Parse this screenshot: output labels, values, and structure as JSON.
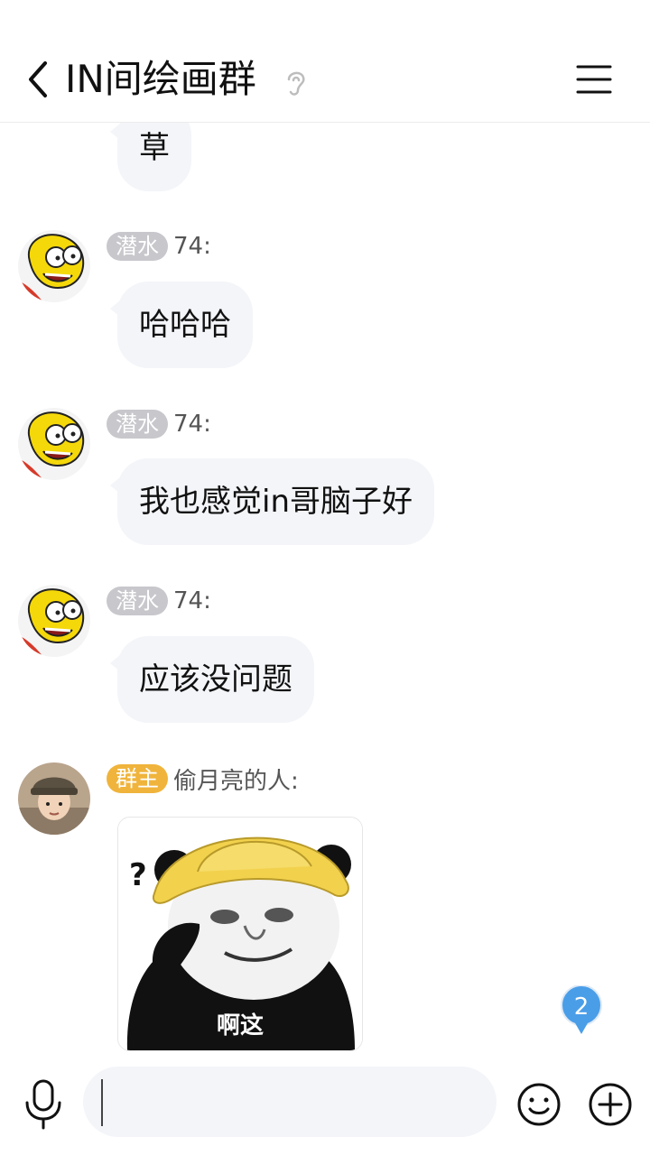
{
  "header": {
    "title": "IN间绘画群",
    "back_icon": "chevron-left-icon",
    "listen_icon": "ear-icon",
    "menu_icon": "hamburger-menu-icon"
  },
  "messages": [
    {
      "type": "text",
      "text": "草"
    },
    {
      "type": "text",
      "badge": "潜水",
      "sender": "74:",
      "text": "哈哈哈"
    },
    {
      "type": "text",
      "badge": "潜水",
      "sender": "74:",
      "text": "我也感觉in哥脑子好"
    },
    {
      "type": "text",
      "badge": "潜水",
      "sender": "74:",
      "text": "应该没问题"
    },
    {
      "type": "sticker",
      "badge": "群主",
      "sender": "偷月亮的人:",
      "sticker_caption": "啊这",
      "sticker_question": "?"
    }
  ],
  "unread_count": "2",
  "input": {
    "value": "",
    "placeholder": ""
  },
  "colors": {
    "bubble": "#f4f5f9",
    "badge_member": "#c7c7cc",
    "badge_owner": "#f0b43c",
    "unread": "#4a9ee8"
  }
}
